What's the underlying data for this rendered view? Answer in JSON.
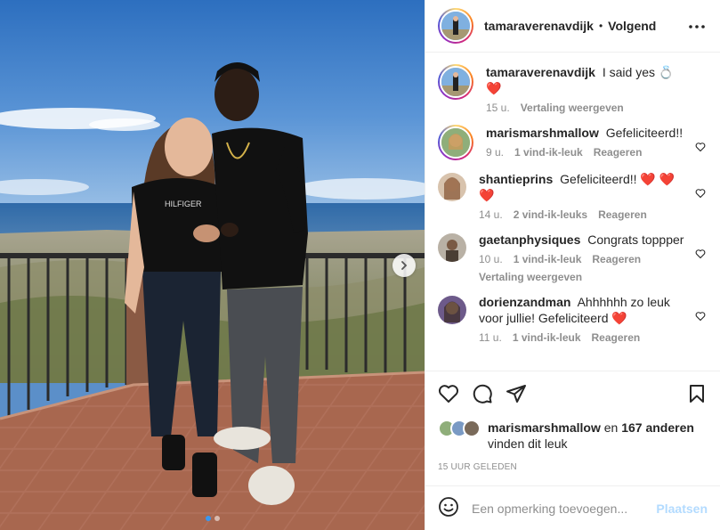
{
  "post": {
    "username": "tamaraverenavdijk",
    "separator": "•",
    "follow_state": "Volgend"
  },
  "caption": {
    "username": "tamaraverenavdijk",
    "text": "I said yes",
    "ring_emoji": "💍",
    "heart_emoji": "❤️",
    "time": "15 u.",
    "translate": "Vertaling weergeven"
  },
  "comments": [
    {
      "username": "marismarshmallow",
      "text": "Gefeliciteerd!!",
      "time": "9 u.",
      "likes": "1 vind-ik-leuk",
      "reply": "Reageren",
      "avatar_color": "#8fae7a"
    },
    {
      "username": "shantieprins",
      "text": "Gefeliciteerd!!",
      "hearts": "❤️ ❤️ ❤️",
      "time": "14 u.",
      "likes": "2 vind-ik-leuks",
      "reply": "Reageren",
      "avatar_color": "#c9a07a"
    },
    {
      "username": "gaetanphysiques",
      "text": "Congrats toppper",
      "time": "10 u.",
      "likes": "1 vind-ik-leuk",
      "reply": "Reageren",
      "translate": "Vertaling weergeven",
      "avatar_color": "#7a6a5a"
    },
    {
      "username": "dorienzandman",
      "text": "Ahhhhhh zo leuk voor jullie! Gefeliciteerd",
      "heart": "❤️",
      "time": "11 u.",
      "likes": "1 vind-ik-leuk",
      "reply": "Reageren",
      "avatar_color": "#6d5a8a"
    }
  ],
  "likes": {
    "user": "marismarshmallow",
    "connector": "en",
    "others": "167 anderen",
    "suffix": "vinden dit leuk"
  },
  "timestamp": "15 UUR GELEDEN",
  "add_comment": {
    "placeholder": "Een opmerking toevoegen...",
    "post_label": "Plaatsen"
  },
  "icons": {
    "like": "heart-outline-icon",
    "comment": "comment-icon",
    "share": "paper-plane-icon",
    "save": "bookmark-icon",
    "emoji": "smiley-icon",
    "more": "more-horizontal-icon",
    "next": "chevron-right-icon"
  },
  "carousel": {
    "count": 2,
    "active_index": 0
  },
  "colors": {
    "link_blue_disabled": "#b3dbff",
    "heart_red": "#ed4956",
    "carousel_active": "#3897f0"
  }
}
